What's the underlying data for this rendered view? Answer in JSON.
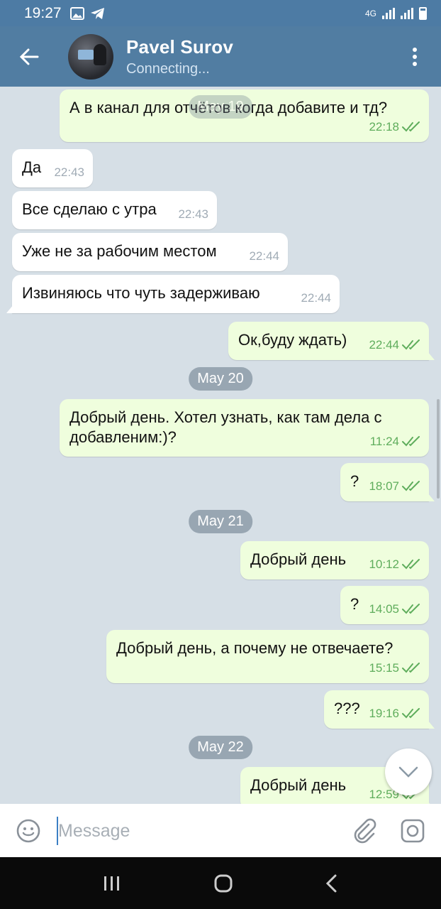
{
  "status_bar": {
    "time": "19:27",
    "network": "4G"
  },
  "header": {
    "title": "Pavel Surov",
    "subtitle": "Connecting..."
  },
  "messages": [
    {
      "dir": "out",
      "text": "А в канал для отчётов когда добавите и тд?",
      "time": "22:18"
    },
    {
      "dir": "in",
      "text": "Да",
      "time": "22:43"
    },
    {
      "dir": "in",
      "text": "Все сделаю с утра",
      "time": "22:43"
    },
    {
      "dir": "in",
      "text": "Уже не за рабочим местом",
      "time": "22:44"
    },
    {
      "dir": "in",
      "text": "Извиняюсь что чуть задерживаю",
      "time": "22:44"
    },
    {
      "dir": "out",
      "text": "Ок,буду ждать)",
      "time": "22:44"
    },
    {
      "dir": "date",
      "text": "May 20"
    },
    {
      "dir": "out",
      "text": "Добрый день. Хотел узнать, как там дела с добавленим:)?",
      "time": "11:24"
    },
    {
      "dir": "out",
      "text": "?",
      "time": "18:07"
    },
    {
      "dir": "date",
      "text": "May 21"
    },
    {
      "dir": "out",
      "text": "Добрый день",
      "time": "10:12"
    },
    {
      "dir": "out",
      "text": "?",
      "time": "14:05"
    },
    {
      "dir": "out",
      "text": "Добрый день, а почему не отвечаете?",
      "time": "15:15"
    },
    {
      "dir": "out",
      "text": "???",
      "time": "19:16"
    },
    {
      "dir": "date",
      "text": "May 22"
    },
    {
      "dir": "out",
      "text": "Добрый день",
      "time": "12:59"
    }
  ],
  "floating_date": "May 19",
  "composer": {
    "placeholder": "Message"
  },
  "colors": {
    "header": "#517da2",
    "status_bar": "#4d7ba4",
    "incoming_bubble": "#ffffff",
    "outgoing_bubble": "#effedd",
    "chat_background": "#d6dfe6",
    "read_check": "#5fad5c"
  }
}
